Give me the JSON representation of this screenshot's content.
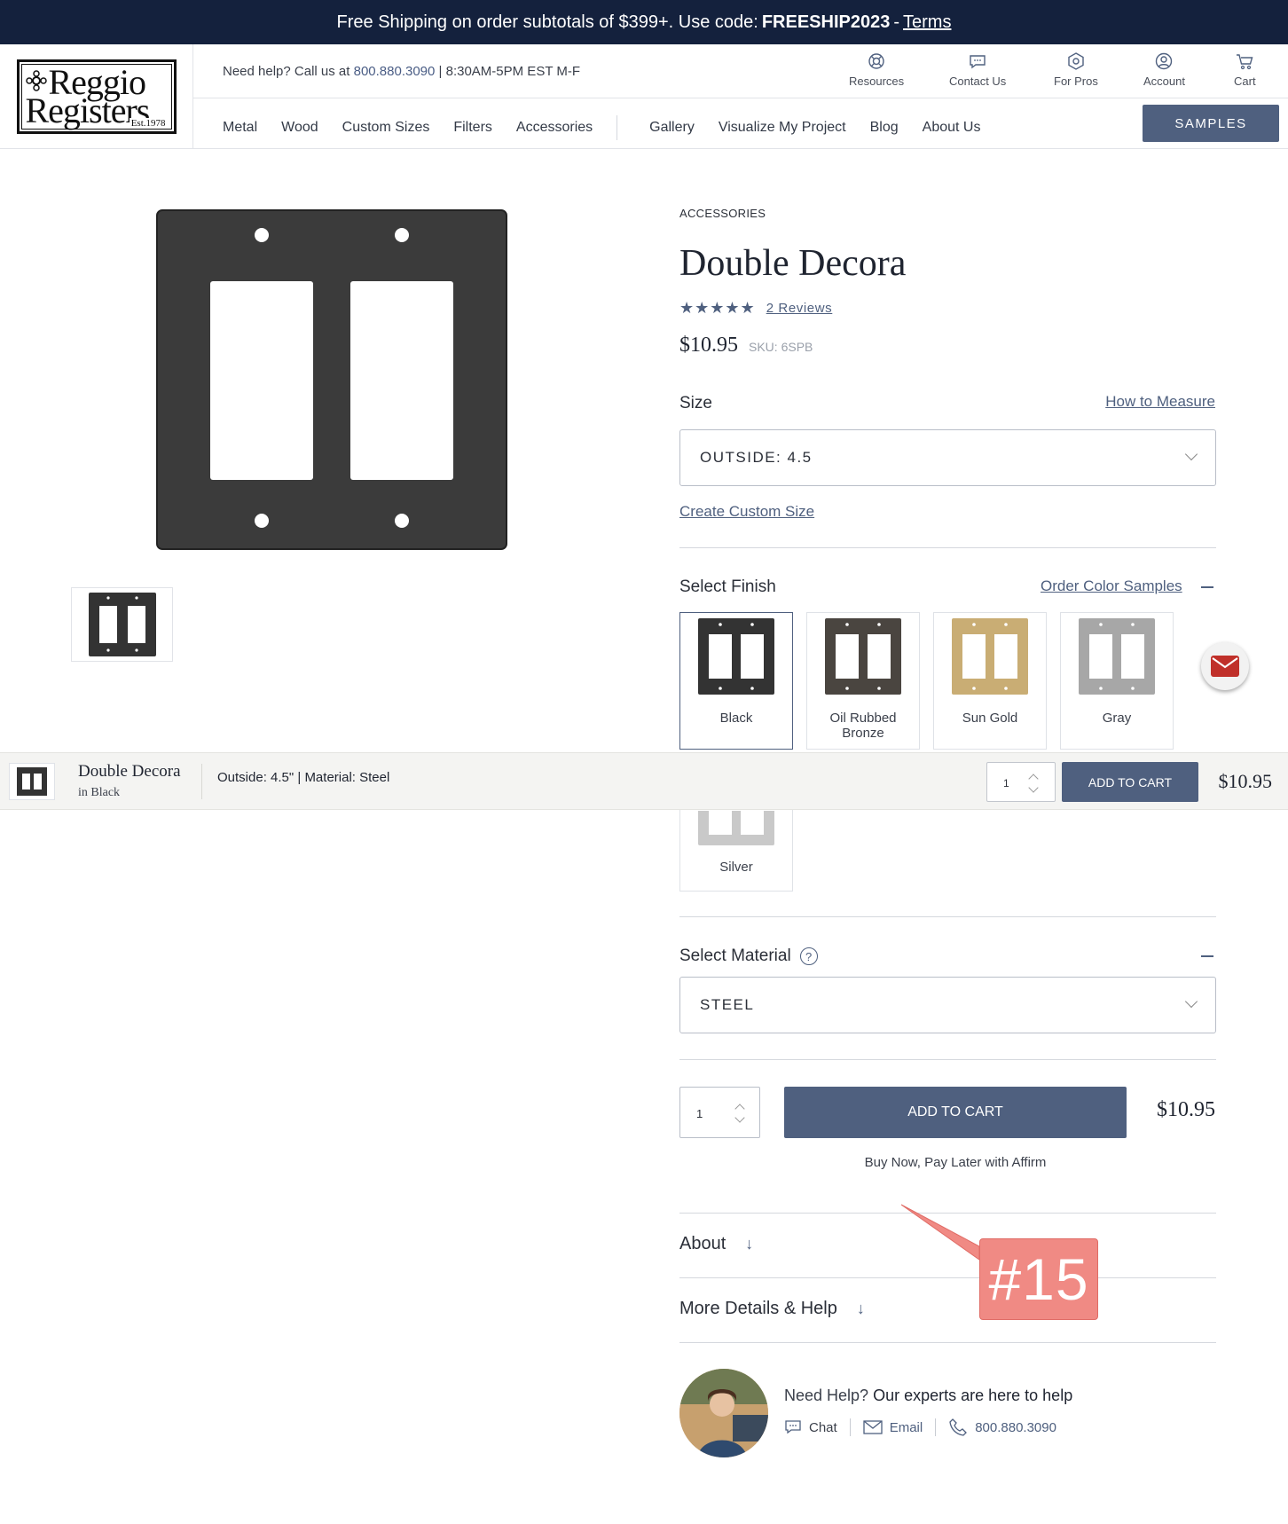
{
  "promo": {
    "text": "Free Shipping on order subtotals of $399+. Use code:",
    "code": "FREESHIP2023",
    "separator": "-",
    "terms": "Terms"
  },
  "logo": {
    "line1": "Reggio",
    "line2": "Registers",
    "est": "Est.1978"
  },
  "header": {
    "help_prefix": "Need help? Call us at",
    "phone": "800.880.3090",
    "hours": "| 8:30AM-5PM EST M-F",
    "utils": [
      "Resources",
      "Contact Us",
      "For Pros",
      "Account",
      "Cart"
    ],
    "nav_left": [
      "Metal",
      "Wood",
      "Custom Sizes",
      "Filters",
      "Accessories"
    ],
    "nav_right": [
      "Gallery",
      "Visualize My Project",
      "Blog",
      "About Us"
    ],
    "samples": "SAMPLES"
  },
  "product": {
    "category": "ACCESSORIES",
    "title": "Double Decora",
    "stars": "★★★★★",
    "reviews": "2 Reviews",
    "price": "$10.95",
    "sku": "SKU: 6SPB",
    "size_label": "Size",
    "measure_link": "How to Measure",
    "size_value": "OUTSIDE: 4.5",
    "custom_size": "Create Custom Size",
    "finish_label": "Select Finish",
    "color_samples": "Order Color Samples",
    "finishes": [
      {
        "name": "Black",
        "color": "#3a3a3a",
        "selected": true
      },
      {
        "name": "Oil Rubbed Bronze",
        "color": "#4a4540"
      },
      {
        "name": "Sun Gold",
        "color": "#c9ad74"
      },
      {
        "name": "Gray",
        "color": "#a7a7a7"
      },
      {
        "name": "Silver",
        "color": "#c9c9c9"
      }
    ],
    "material_label": "Select Material",
    "material_help": "?",
    "material_value": "STEEL",
    "qty": "1",
    "add_to_cart": "ADD TO CART",
    "affirm": "Buy Now, Pay Later with Affirm",
    "about": "About",
    "more_details": "More Details & Help"
  },
  "help": {
    "title_prefix": "Need Help?",
    "title_strong": "Our experts are here to help",
    "chat": "Chat",
    "email": "Email",
    "phone": "800.880.3090"
  },
  "sticky": {
    "name": "Double Decora",
    "finish": "in Black",
    "options": "Outside: 4.5\" | Material: Steel",
    "qty": "1",
    "button": "ADD TO CART",
    "price": "$10.95"
  },
  "annotation": {
    "label": "#15"
  },
  "colors": {
    "navy": "#14213d",
    "accent": "#4f607f",
    "annotation": "#f08a84"
  }
}
